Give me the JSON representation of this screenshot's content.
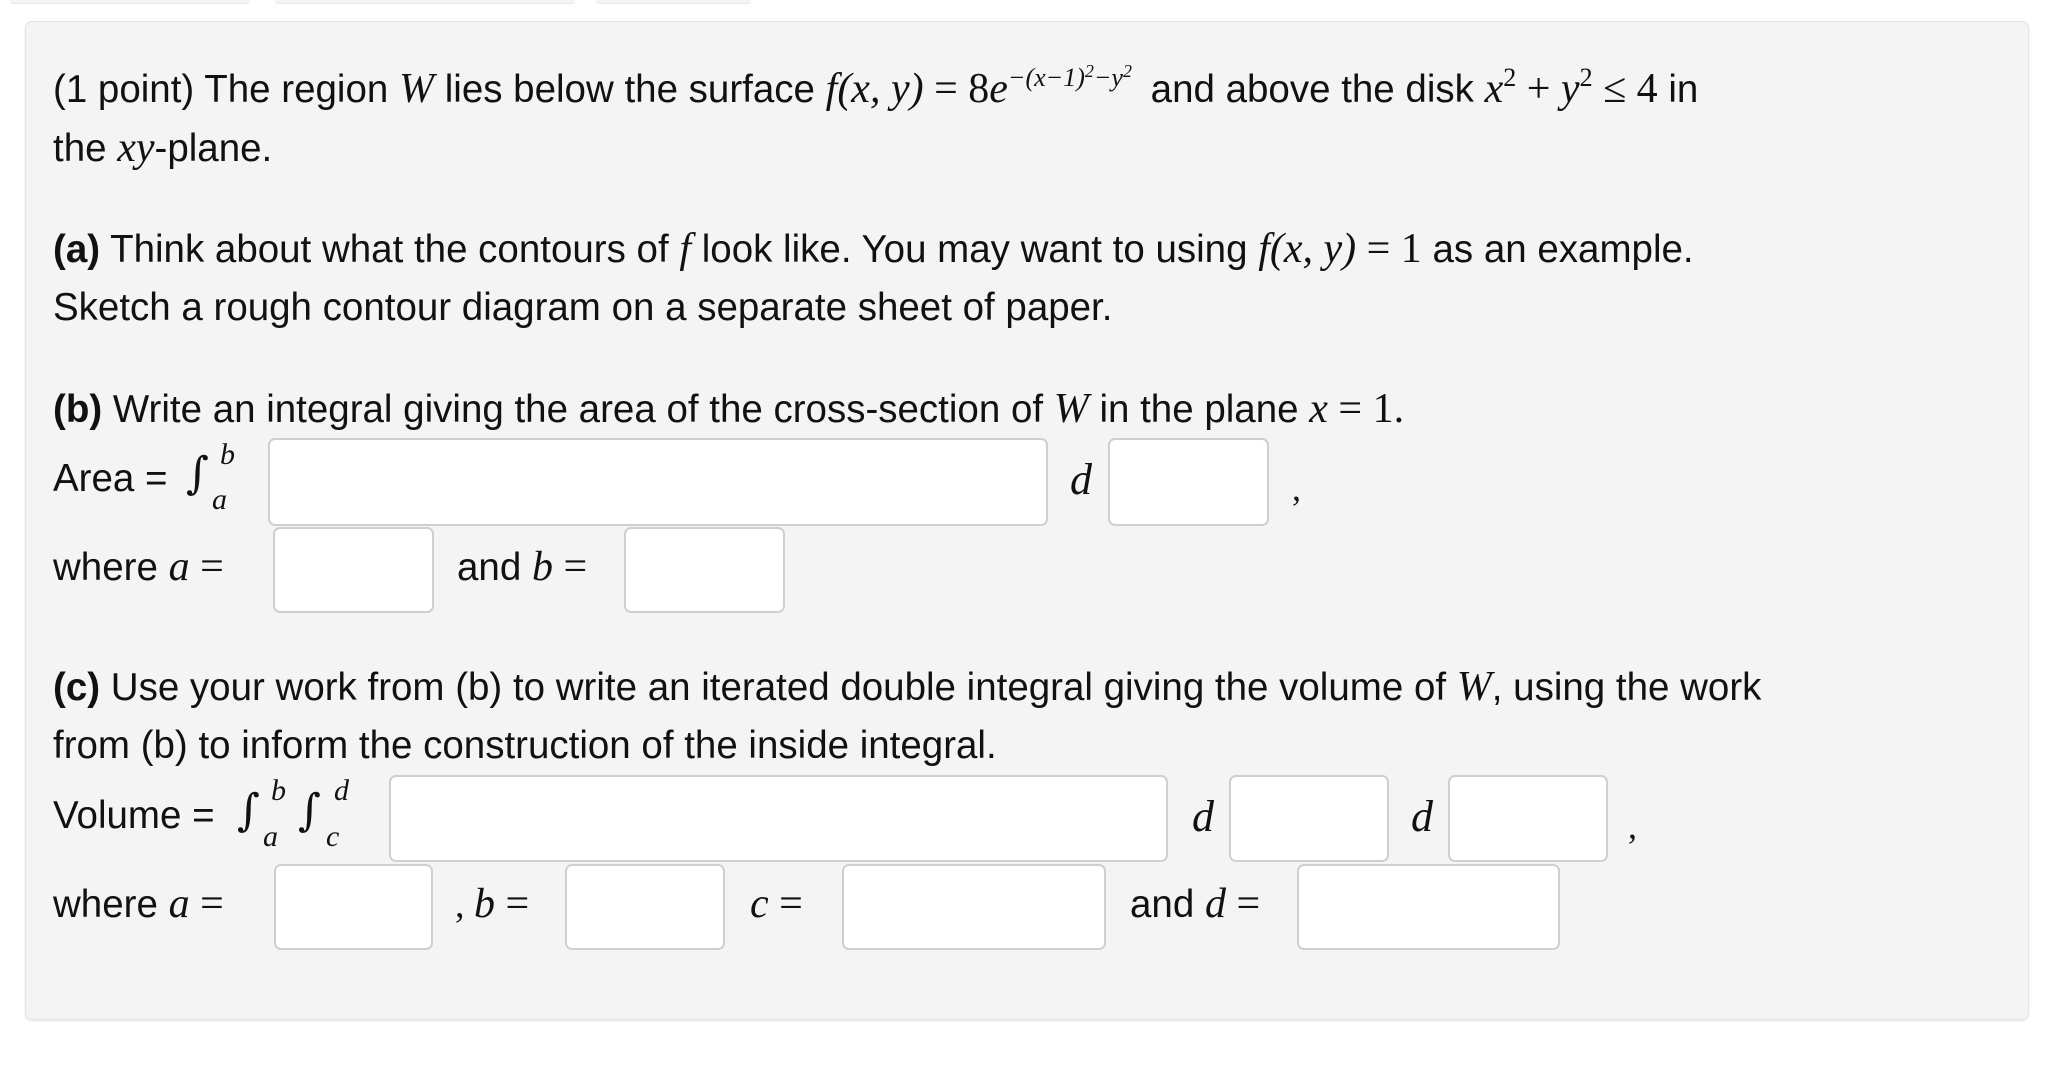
{
  "problem": {
    "points": "(1 point)",
    "intro": {
      "t1": " The region ",
      "W": "W",
      "t2": " lies below the surface ",
      "fx": "f",
      "args": "(x, y)",
      "eq": " = 8",
      "e": "e",
      "exp": "−(x−1)",
      "exp2": "2",
      "exp3": "−y",
      "exp4": "2",
      "t3": " and above the disk ",
      "x": "x",
      "sq": "2",
      "plus": " + ",
      "y": "y",
      "sq2": "2",
      "leq": " ≤ 4",
      "t4": " in",
      "line2a": "the ",
      "xy": "xy",
      "line2b": "-plane."
    },
    "part_a": {
      "label": "(a)",
      "t1": " Think about what the contours of ",
      "f": "f",
      "t2": " look like. You may want to using ",
      "f2": "f",
      "args": "(x, y)",
      "eq": " = 1",
      "t3": " as an example.",
      "line2": "Sketch a rough contour diagram on a separate sheet of paper."
    },
    "part_b": {
      "label": "(b)",
      "t1": " Write an integral giving the area of the cross-section of ",
      "W": "W",
      "t2": " in the plane ",
      "x": "x",
      "eq": " = 1.",
      "area_label": "Area = ",
      "integral_sign": "∫",
      "upper": "b",
      "lower": "a",
      "d": "d",
      "comma": ",",
      "where": "where ",
      "a": "a",
      "eq_sign": " =",
      "and": "and ",
      "b": "b",
      "integrand_value": "",
      "dvar_value": "",
      "a_value": "",
      "b_value": ""
    },
    "part_c": {
      "label": "(c)",
      "t1": " Use your work from (b) to write an iterated double integral giving the volume of ",
      "W": "W",
      "t2": ", using the work",
      "line2": "from (b) to inform the construction of the inside integral.",
      "volume_label": "Volume = ",
      "integral_sign": "∫",
      "outer_upper": "b",
      "outer_lower": "a",
      "inner_upper": "d",
      "inner_lower": "c",
      "d": "d",
      "comma": ",",
      "where": "where ",
      "a": "a",
      "b": "b",
      "c": "c",
      "dv": "d",
      "eq_sign": " =",
      "sep_comma": ", ",
      "and": "and ",
      "integrand_value": "",
      "dvar1_value": "",
      "dvar2_value": "",
      "a_value": "",
      "b_value": "",
      "c_value": "",
      "d_value": ""
    }
  }
}
